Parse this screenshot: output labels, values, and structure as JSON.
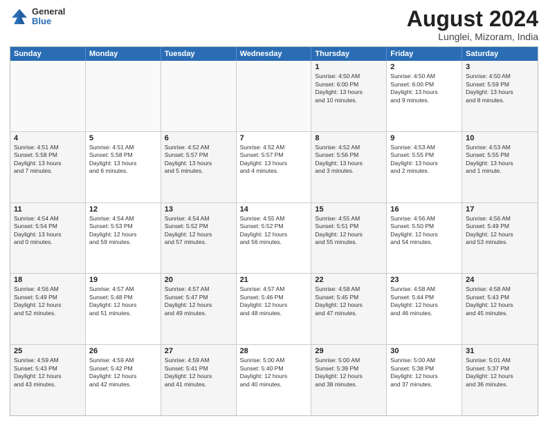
{
  "logo": {
    "general": "General",
    "blue": "Blue"
  },
  "title": "August 2024",
  "location": "Lunglei, Mizoram, India",
  "days_of_week": [
    "Sunday",
    "Monday",
    "Tuesday",
    "Wednesday",
    "Thursday",
    "Friday",
    "Saturday"
  ],
  "weeks": [
    [
      {
        "day": "",
        "info": ""
      },
      {
        "day": "",
        "info": ""
      },
      {
        "day": "",
        "info": ""
      },
      {
        "day": "",
        "info": ""
      },
      {
        "day": "1",
        "info": "Sunrise: 4:50 AM\nSunset: 6:00 PM\nDaylight: 13 hours\nand 10 minutes."
      },
      {
        "day": "2",
        "info": "Sunrise: 4:50 AM\nSunset: 6:00 PM\nDaylight: 13 hours\nand 9 minutes."
      },
      {
        "day": "3",
        "info": "Sunrise: 4:50 AM\nSunset: 5:59 PM\nDaylight: 13 hours\nand 8 minutes."
      }
    ],
    [
      {
        "day": "4",
        "info": "Sunrise: 4:51 AM\nSunset: 5:58 PM\nDaylight: 13 hours\nand 7 minutes."
      },
      {
        "day": "5",
        "info": "Sunrise: 4:51 AM\nSunset: 5:58 PM\nDaylight: 13 hours\nand 6 minutes."
      },
      {
        "day": "6",
        "info": "Sunrise: 4:52 AM\nSunset: 5:57 PM\nDaylight: 13 hours\nand 5 minutes."
      },
      {
        "day": "7",
        "info": "Sunrise: 4:52 AM\nSunset: 5:57 PM\nDaylight: 13 hours\nand 4 minutes."
      },
      {
        "day": "8",
        "info": "Sunrise: 4:52 AM\nSunset: 5:56 PM\nDaylight: 13 hours\nand 3 minutes."
      },
      {
        "day": "9",
        "info": "Sunrise: 4:53 AM\nSunset: 5:55 PM\nDaylight: 13 hours\nand 2 minutes."
      },
      {
        "day": "10",
        "info": "Sunrise: 4:53 AM\nSunset: 5:55 PM\nDaylight: 13 hours\nand 1 minute."
      }
    ],
    [
      {
        "day": "11",
        "info": "Sunrise: 4:54 AM\nSunset: 5:54 PM\nDaylight: 13 hours\nand 0 minutes."
      },
      {
        "day": "12",
        "info": "Sunrise: 4:54 AM\nSunset: 5:53 PM\nDaylight: 12 hours\nand 59 minutes."
      },
      {
        "day": "13",
        "info": "Sunrise: 4:54 AM\nSunset: 5:52 PM\nDaylight: 12 hours\nand 57 minutes."
      },
      {
        "day": "14",
        "info": "Sunrise: 4:55 AM\nSunset: 5:52 PM\nDaylight: 12 hours\nand 56 minutes."
      },
      {
        "day": "15",
        "info": "Sunrise: 4:55 AM\nSunset: 5:51 PM\nDaylight: 12 hours\nand 55 minutes."
      },
      {
        "day": "16",
        "info": "Sunrise: 4:56 AM\nSunset: 5:50 PM\nDaylight: 12 hours\nand 54 minutes."
      },
      {
        "day": "17",
        "info": "Sunrise: 4:56 AM\nSunset: 5:49 PM\nDaylight: 12 hours\nand 53 minutes."
      }
    ],
    [
      {
        "day": "18",
        "info": "Sunrise: 4:56 AM\nSunset: 5:49 PM\nDaylight: 12 hours\nand 52 minutes."
      },
      {
        "day": "19",
        "info": "Sunrise: 4:57 AM\nSunset: 5:48 PM\nDaylight: 12 hours\nand 51 minutes."
      },
      {
        "day": "20",
        "info": "Sunrise: 4:57 AM\nSunset: 5:47 PM\nDaylight: 12 hours\nand 49 minutes."
      },
      {
        "day": "21",
        "info": "Sunrise: 4:57 AM\nSunset: 5:46 PM\nDaylight: 12 hours\nand 48 minutes."
      },
      {
        "day": "22",
        "info": "Sunrise: 4:58 AM\nSunset: 5:45 PM\nDaylight: 12 hours\nand 47 minutes."
      },
      {
        "day": "23",
        "info": "Sunrise: 4:58 AM\nSunset: 5:44 PM\nDaylight: 12 hours\nand 46 minutes."
      },
      {
        "day": "24",
        "info": "Sunrise: 4:58 AM\nSunset: 5:43 PM\nDaylight: 12 hours\nand 45 minutes."
      }
    ],
    [
      {
        "day": "25",
        "info": "Sunrise: 4:59 AM\nSunset: 5:43 PM\nDaylight: 12 hours\nand 43 minutes."
      },
      {
        "day": "26",
        "info": "Sunrise: 4:59 AM\nSunset: 5:42 PM\nDaylight: 12 hours\nand 42 minutes."
      },
      {
        "day": "27",
        "info": "Sunrise: 4:59 AM\nSunset: 5:41 PM\nDaylight: 12 hours\nand 41 minutes."
      },
      {
        "day": "28",
        "info": "Sunrise: 5:00 AM\nSunset: 5:40 PM\nDaylight: 12 hours\nand 40 minutes."
      },
      {
        "day": "29",
        "info": "Sunrise: 5:00 AM\nSunset: 5:39 PM\nDaylight: 12 hours\nand 38 minutes."
      },
      {
        "day": "30",
        "info": "Sunrise: 5:00 AM\nSunset: 5:38 PM\nDaylight: 12 hours\nand 37 minutes."
      },
      {
        "day": "31",
        "info": "Sunrise: 5:01 AM\nSunset: 5:37 PM\nDaylight: 12 hours\nand 36 minutes."
      }
    ]
  ]
}
